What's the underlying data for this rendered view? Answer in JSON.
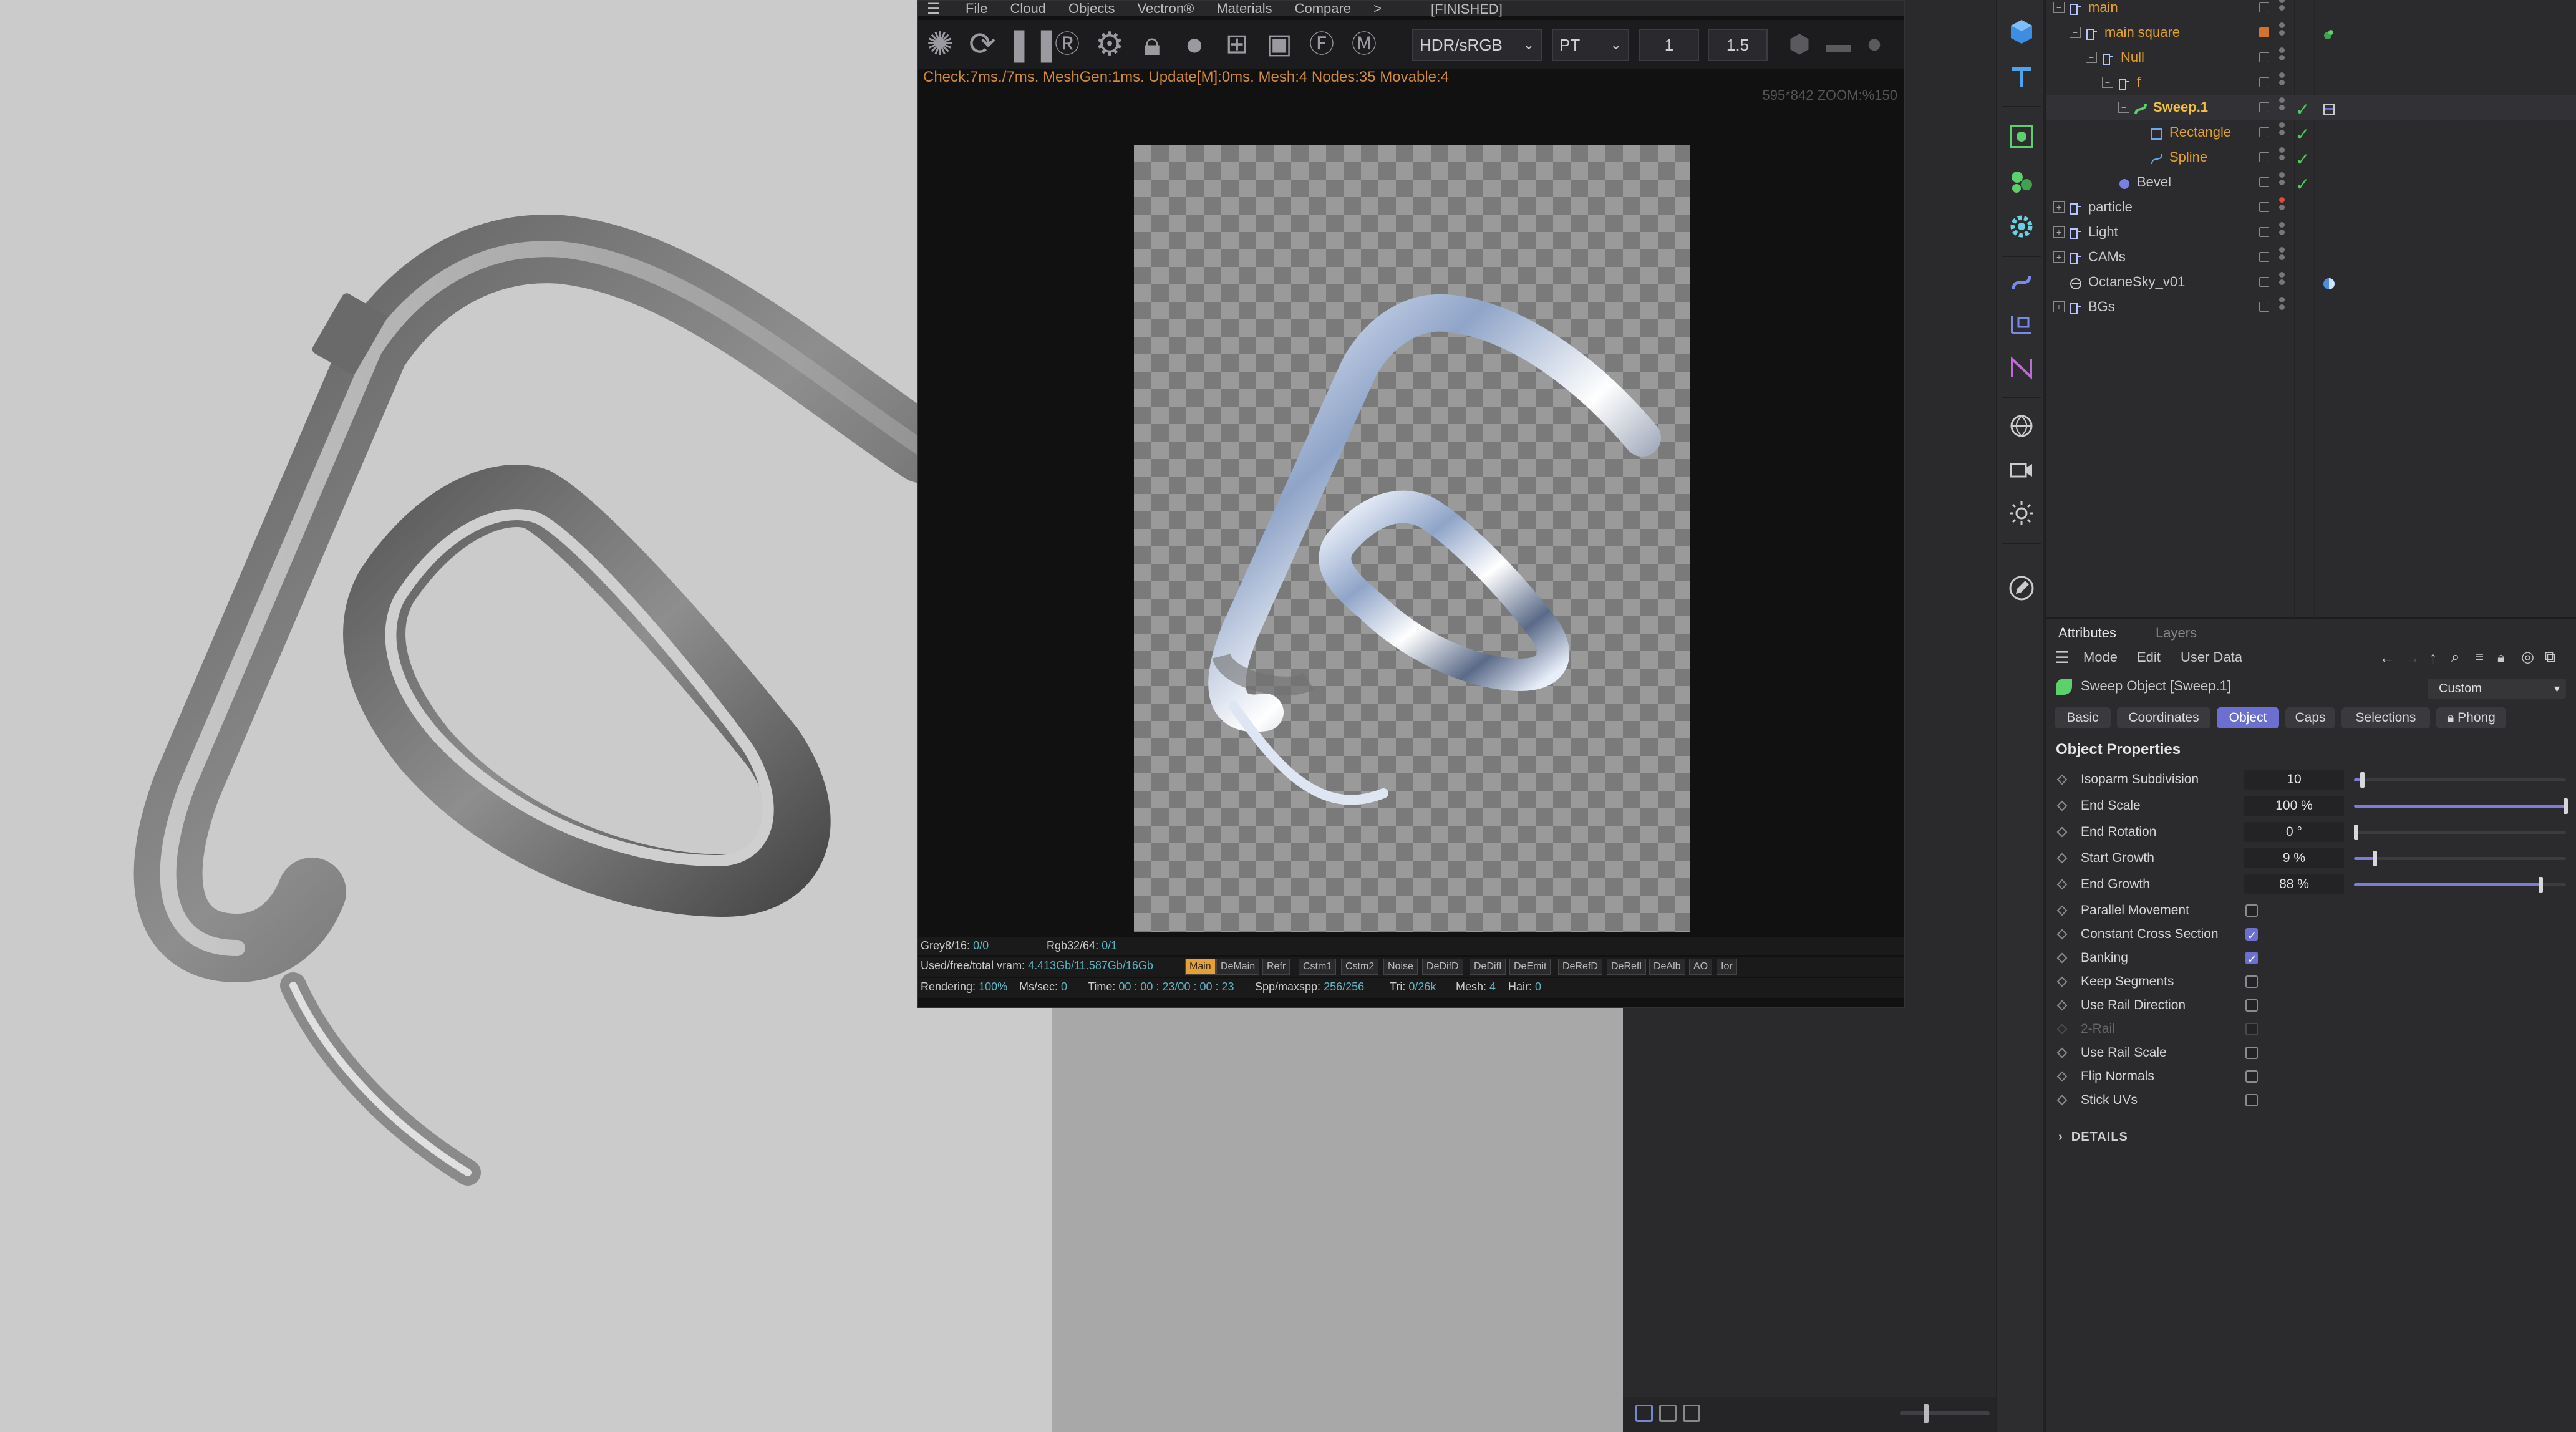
{
  "octane": {
    "menu": [
      "File",
      "Cloud",
      "Objects",
      "Vectron®",
      "Materials",
      "Compare",
      ">"
    ],
    "status": "[FINISHED]",
    "colorspace": "HDR/sRGB",
    "kernel": "PT",
    "num1": "1",
    "num2": "1.5",
    "check_line": "Check:7ms./7ms. MeshGen:1ms. Update[M]:0ms. Mesh:4 Nodes:35 Movable:4",
    "res_zoom": "595*842 ZOOM:%150",
    "stats": {
      "grey_label": "Grey8/16:",
      "grey_val": "0/0",
      "rgb_label": "Rgb32/64:",
      "rgb_val": "0/1",
      "vram_label": "Used/free/total vram:",
      "vram_val": "4.413Gb/11.587Gb/16Gb",
      "rendering_label": "Rendering:",
      "rendering_val": "100%",
      "ms_label": "Ms/sec:",
      "ms_val": "0",
      "time_label": "Time:",
      "time_val": "00 : 00 : 23/00 : 00 : 23",
      "spp_label": "Spp/maxspp:",
      "spp_val": "256/256",
      "tri_label": "Tri:",
      "tri_val": "0/26k",
      "mesh_label": "Mesh:",
      "mesh_val": "4",
      "hair_label": "Hair:",
      "hair_val": "0"
    },
    "passes": [
      "Main",
      "DeMain",
      "Refr",
      "Cstm1",
      "Cstm2",
      "Noise",
      "DeDifD",
      "DeDifI",
      "DeEmit",
      "DeRefD",
      "DeRefl",
      "DeAlb",
      "AO",
      "Ior"
    ]
  },
  "objects": [
    {
      "name": "main",
      "depth": 0,
      "color": "#e0a030",
      "kind": "null"
    },
    {
      "name": "main square",
      "depth": 1,
      "color": "#e0a030",
      "kind": "null"
    },
    {
      "name": "Null",
      "depth": 2,
      "color": "#e0a030",
      "kind": "null"
    },
    {
      "name": "f",
      "depth": 3,
      "color": "#e0a030",
      "kind": "null"
    },
    {
      "name": "Sweep.1",
      "depth": 4,
      "color": "#f0c040",
      "kind": "sweep"
    },
    {
      "name": "Rectangle",
      "depth": 5,
      "color": "#e0a030",
      "kind": "rect"
    },
    {
      "name": "Spline",
      "depth": 5,
      "color": "#e0a030",
      "kind": "spline"
    },
    {
      "name": "Bevel",
      "depth": 3,
      "color": "#c9c9cc",
      "kind": "bevel"
    },
    {
      "name": "particle",
      "depth": 0,
      "color": "#c9c9cc",
      "kind": "null"
    },
    {
      "name": "Light",
      "depth": 0,
      "color": "#c9c9cc",
      "kind": "null"
    },
    {
      "name": "CAMs",
      "depth": 0,
      "color": "#c9c9cc",
      "kind": "null"
    },
    {
      "name": "OctaneSky_v01",
      "depth": 0,
      "color": "#c9c9cc",
      "kind": "sky"
    },
    {
      "name": "BGs",
      "depth": 0,
      "color": "#c9c9cc",
      "kind": "null"
    }
  ],
  "attributes": {
    "tabs": [
      "Attributes",
      "Layers"
    ],
    "menubar": [
      "Mode",
      "Edit",
      "User Data"
    ],
    "object_name": "Sweep Object [Sweep.1]",
    "preset": "Custom",
    "subtabs": [
      "Basic",
      "Coordinates",
      "Object",
      "Caps",
      "Selections",
      "Phong"
    ],
    "active_subtab": "Object",
    "section_title": "Object Properties",
    "numeric": [
      {
        "label": "Isoparm Subdivision",
        "value": "10",
        "fraction": 0.03
      },
      {
        "label": "End Scale",
        "value": "100 %",
        "fraction": 1.0
      },
      {
        "label": "End Rotation",
        "value": "0 °",
        "fraction": 0.0
      },
      {
        "label": "Start Growth",
        "value": "9 %",
        "fraction": 0.09
      },
      {
        "label": "End Growth",
        "value": "88 %",
        "fraction": 0.88
      }
    ],
    "checkboxes": [
      {
        "label": "Parallel Movement",
        "checked": false,
        "disabled": false
      },
      {
        "label": "Constant Cross Section",
        "checked": true,
        "disabled": false
      },
      {
        "label": "Banking",
        "checked": true,
        "disabled": false
      },
      {
        "label": "Keep Segments",
        "checked": false,
        "disabled": false
      },
      {
        "label": "Use Rail Direction",
        "checked": false,
        "disabled": false
      },
      {
        "label": "2-Rail",
        "checked": false,
        "disabled": true
      },
      {
        "label": "Use Rail Scale",
        "checked": false,
        "disabled": false
      },
      {
        "label": "Flip Normals",
        "checked": false,
        "disabled": false
      },
      {
        "label": "Stick UVs",
        "checked": false,
        "disabled": false
      }
    ],
    "details": "DETAILS"
  },
  "colors": {
    "accent": "#6a6fd0",
    "object_orange": "#e0a030",
    "check_green": "#4fcc5a",
    "stats_value": "#5fb3c3",
    "warn_text": "#d08a3a"
  }
}
